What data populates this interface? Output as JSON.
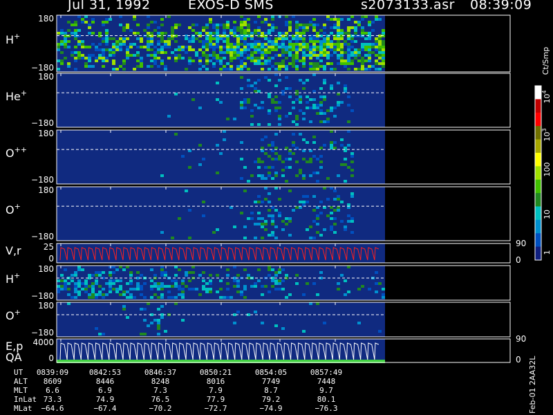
{
  "header": {
    "date": "Jul 31, 1992",
    "instrument": "EXOS-D SMS",
    "file": "s2073133.asr",
    "time": "08:39:09"
  },
  "panels": [
    {
      "label": "H",
      "sup": "+",
      "top_tick": "180",
      "bottom_tick": "−180"
    },
    {
      "label": "He",
      "sup": "+",
      "top_tick": "180",
      "bottom_tick": "−180"
    },
    {
      "label": "O",
      "sup": "++",
      "top_tick": "180",
      "bottom_tick": "−180"
    },
    {
      "label": "O",
      "sup": "+",
      "top_tick": "180",
      "bottom_tick": "−180"
    },
    {
      "label": "V,r",
      "sup": "",
      "top_tick": "25",
      "bottom_tick": "0",
      "right_top": "90",
      "right_bottom": "0"
    },
    {
      "label": "H",
      "sup": "+",
      "top_tick": "180",
      "bottom_tick": "−180"
    },
    {
      "label": "O",
      "sup": "+",
      "top_tick": "180",
      "bottom_tick": "−180"
    },
    {
      "label": "E,p",
      "label2": "QA",
      "sup": "",
      "top_tick": "4000",
      "bottom_tick": "0",
      "right_top": "90",
      "right_bottom": "0"
    }
  ],
  "colorbar": {
    "unit": "Ct/Smp",
    "ticks": [
      "10",
      "10",
      "100",
      "10",
      "1"
    ],
    "exponents": [
      "4",
      "3",
      "",
      "",
      ""
    ],
    "colors": [
      "#ffffff",
      "#c00000",
      "#ff0000",
      "#707000",
      "#a8a800",
      "#ffff00",
      "#a0e000",
      "#40c000",
      "#208820",
      "#00c0c0",
      "#0090d0",
      "#0050c0",
      "#102080"
    ]
  },
  "footer": {
    "rows": [
      {
        "name": "UT",
        "values": [
          "0839:09",
          "0842:53",
          "0846:37",
          "0850:21",
          "0854:05",
          "0857:49"
        ]
      },
      {
        "name": "ALT",
        "values": [
          "8609",
          "8446",
          "8248",
          "8016",
          "7749",
          "7448"
        ]
      },
      {
        "name": "MLT",
        "values": [
          "6.6",
          "6.9",
          "7.3",
          "7.9",
          "8.7",
          "9.7"
        ]
      },
      {
        "name": "InLat",
        "values": [
          "73.3",
          "74.9",
          "76.5",
          "77.9",
          "79.2",
          "80.1"
        ]
      },
      {
        "name": "MLat",
        "values": [
          "−64.6",
          "−67.4",
          "−70.2",
          "−72.7",
          "−74.9",
          "−76.3"
        ]
      }
    ],
    "stamp": "Feb-01 2AA32L"
  },
  "chart_data": {
    "type": "heatmap",
    "colors": {
      "background": "#000000",
      "panel_fill": "#102a80",
      "frame": "#ffffff"
    },
    "series": [
      {
        "name": "H+"
      },
      {
        "name": "He+"
      },
      {
        "name": "O++"
      },
      {
        "name": "O+"
      },
      {
        "name": "V,r"
      },
      {
        "name": "H+"
      },
      {
        "name": "O+"
      },
      {
        "name": "E,p"
      }
    ]
  }
}
